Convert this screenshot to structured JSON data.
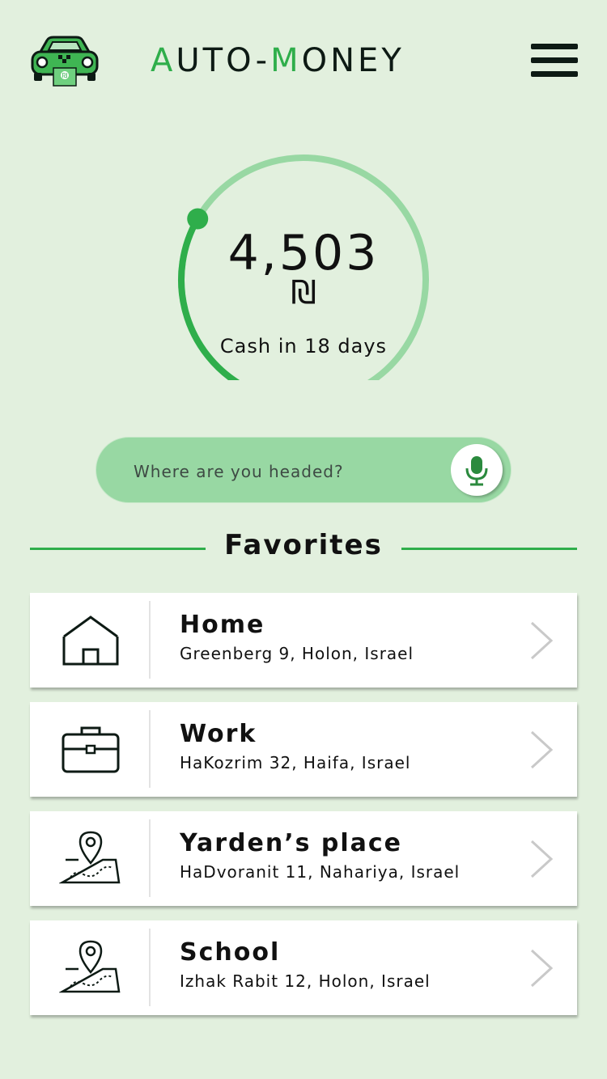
{
  "header": {
    "brand_part1": "A",
    "brand_part2": "UTO-",
    "brand_part3": "M",
    "brand_part4": "ONEY",
    "logo_icon": "car-money-icon",
    "menu_icon": "hamburger-icon"
  },
  "balance": {
    "amount": "4,503",
    "currency_symbol": "₪",
    "cash_label": "Cash in 18 days",
    "progress": 0.3
  },
  "search": {
    "placeholder": "Where are you headed?",
    "mic_icon": "microphone-icon"
  },
  "favorites": {
    "title": "Favorites",
    "items": [
      {
        "name": "Home",
        "address": "Greenberg 9, Holon, Israel",
        "icon": "home-icon"
      },
      {
        "name": "Work",
        "address": "HaKozrim 32, Haifa, Israel",
        "icon": "briefcase-icon"
      },
      {
        "name": "Yarden’s place",
        "address": "HaDvoranit 11, Nahariya, Israel",
        "icon": "map-pin-icon"
      },
      {
        "name": "School",
        "address": "Izhak Rabit 12, Holon, Israel",
        "icon": "map-pin-icon"
      }
    ]
  },
  "colors": {
    "background": "#e2f0de",
    "accent": "#2fae4b",
    "accent_light": "#98d8a3",
    "dark": "#0d1a14"
  }
}
